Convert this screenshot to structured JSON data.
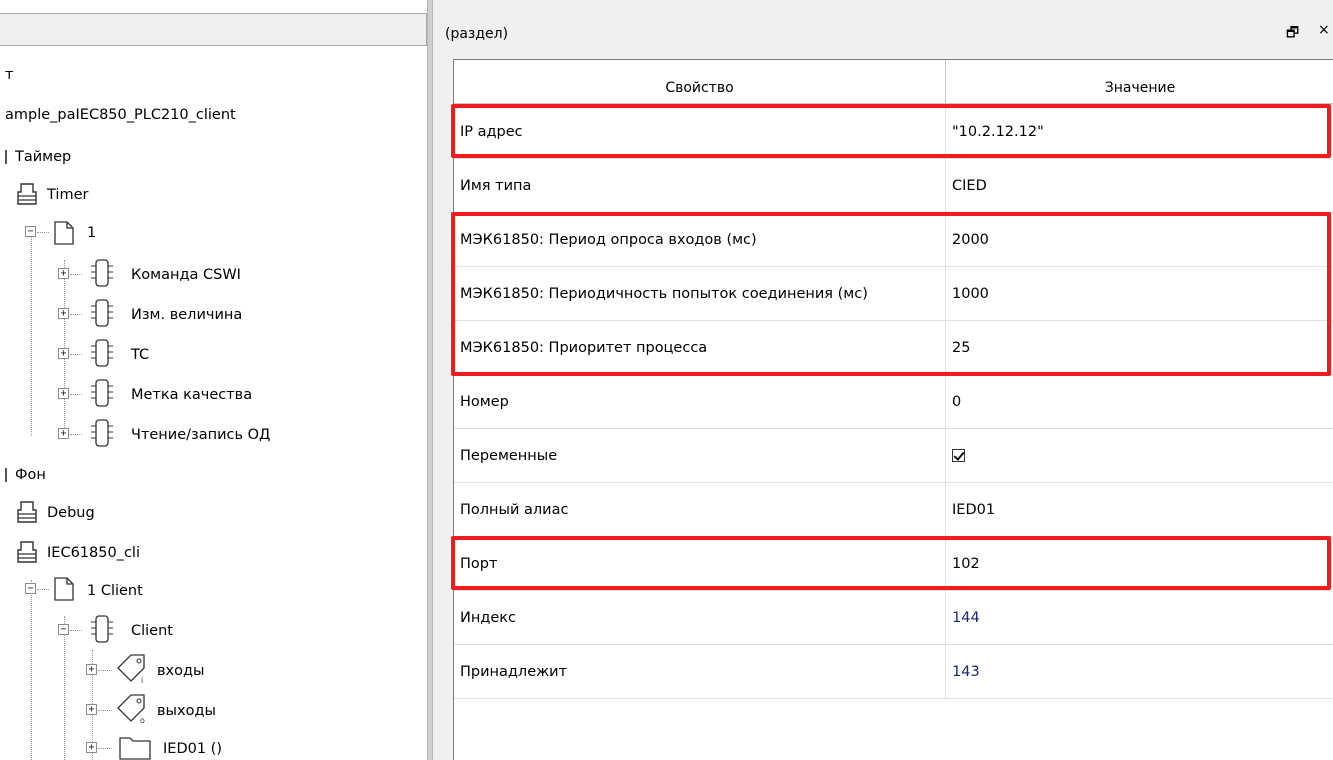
{
  "tree": {
    "nodes": [
      "т",
      "ample_paIEC850_PLC210_client",
      "Таймер",
      "Timer",
      "1",
      "Команда CSWI",
      "Изм. величина",
      "TC",
      "Метка качества",
      "Чтение/запись ОД",
      "Фон",
      "Debug",
      "IEC61850_cli",
      "1 Client",
      "Client",
      "входы",
      "выходы",
      "IED01 ()"
    ],
    "icons": [
      "printer-icon",
      "page-icon",
      "block-icon",
      "tag-icon",
      "folder-icon"
    ]
  },
  "panel": {
    "title": "(раздел)",
    "float_glyph": "🗗",
    "close_glyph": "×"
  },
  "grid": {
    "headers": {
      "property": "Свойство",
      "value": "Значение"
    },
    "rows": [
      {
        "name": "IP адрес",
        "value": "\"10.2.12.12\""
      },
      {
        "name": "Имя типа",
        "value": "CIED"
      },
      {
        "name": "МЭК61850: Период опроса входов (мс)",
        "value": "2000"
      },
      {
        "name": "МЭК61850: Периодичность попыток соединения (мс)",
        "value": "1000"
      },
      {
        "name": "МЭК61850: Приоритет процесса",
        "value": "25"
      },
      {
        "name": "Номер",
        "value": "0"
      },
      {
        "name": "Переменные",
        "value": ""
      },
      {
        "name": "Полный алиас",
        "value": "IED01"
      },
      {
        "name": "Порт",
        "value": "102"
      },
      {
        "name": "Индекс",
        "value": "144"
      },
      {
        "name": "Принадлежит",
        "value": "143"
      }
    ],
    "checkbox_checked": true
  },
  "colors": {
    "highlight": "#ee1c1c",
    "link": "#1a237e",
    "panel_bg": "#f0f0f0"
  }
}
